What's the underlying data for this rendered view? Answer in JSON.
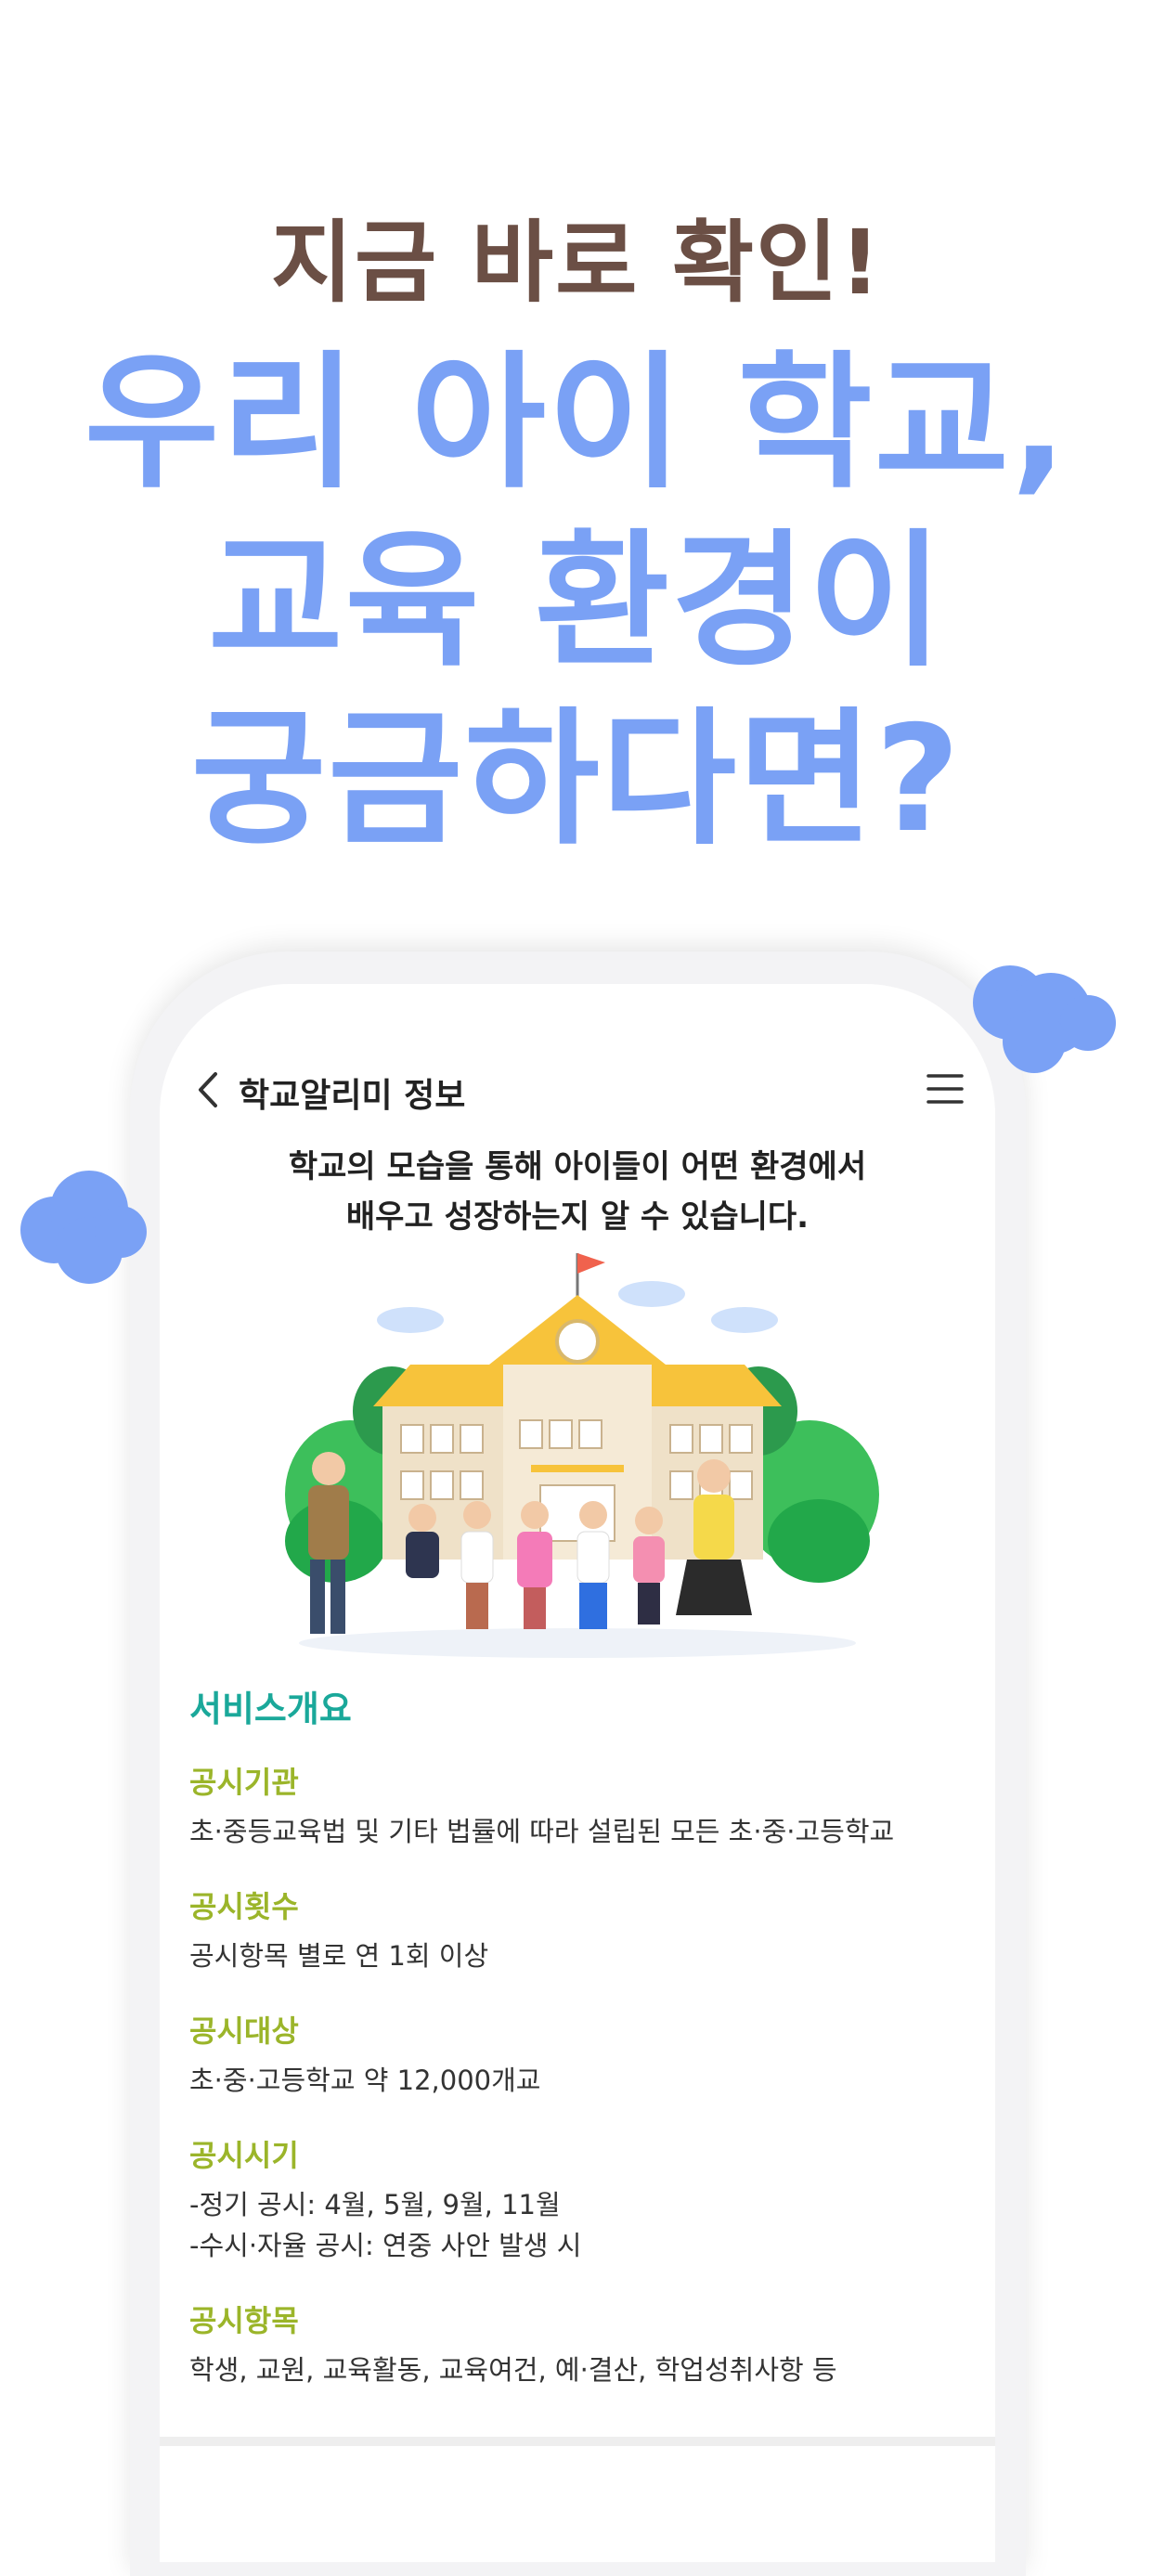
{
  "headline": {
    "top": "지금 바로 확인!",
    "lines": [
      "우리 아이 학교,",
      "교육 환경이",
      "궁금하다면?"
    ]
  },
  "colors": {
    "headline_top": "#6b4f45",
    "headline_main": "#7aa1f5",
    "section_title": "#1aa89a",
    "item_label": "#9bb52a",
    "cloud": "#7aa1f5"
  },
  "app": {
    "nav": {
      "back_icon": "chevron-left-icon",
      "title": "학교알리미 정보",
      "menu_icon": "hamburger-menu-icon"
    },
    "intro_lines": [
      "학교의 모습을 통해 아이들이 어떤 환경에서",
      "배우고 성장하는지 알 수 있습니다."
    ],
    "illustration": "school-building-with-children-illustration",
    "section_title": "서비스개요",
    "items": [
      {
        "label": "공시기관",
        "lines": [
          "초·중등교육법 및 기타 법률에 따라 설립된 모든 초·중·고등학교"
        ]
      },
      {
        "label": "공시횟수",
        "lines": [
          "공시항목 별로 연 1회 이상"
        ]
      },
      {
        "label": "공시대상",
        "lines": [
          "초·중·고등학교 약 12,000개교"
        ]
      },
      {
        "label": "공시시기",
        "lines": [
          "-정기 공시: 4월, 5월, 9월, 11월",
          "-수시·자율 공시: 연중 사안 발생 시"
        ]
      },
      {
        "label": "공시항목",
        "lines": [
          "학생, 교원, 교육활동, 교육여건, 예·결산, 학업성취사항 등"
        ]
      }
    ]
  }
}
